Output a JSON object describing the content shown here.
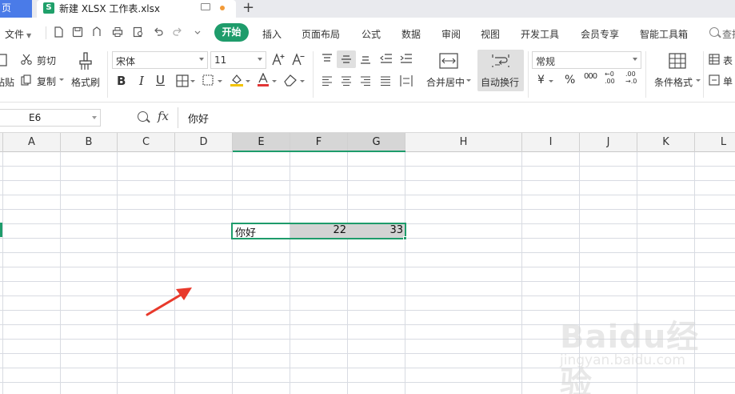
{
  "tabbar": {
    "home_label": "页",
    "file_icon_letter": "S",
    "file_title": "新建 XLSX 工作表.xlsx",
    "add_label": "+"
  },
  "menubar": {
    "file_label": "文件",
    "items": [
      "插入",
      "页面布局",
      "公式",
      "数据",
      "审阅",
      "视图",
      "开发工具",
      "会员专享",
      "智能工具箱"
    ],
    "active_label": "开始",
    "search_label": "查找"
  },
  "ribbon": {
    "paste_label": "粘贴",
    "cut_label": "剪切",
    "copy_label": "复制",
    "format_painter_label": "格式刷",
    "font_name": "宋体",
    "font_size": "11",
    "merge_label": "合并居中",
    "wrap_label": "自动换行",
    "number_format": "常规",
    "conditional_format_label": "条件格式",
    "table_style_label": "表",
    "single_label": "单"
  },
  "formula": {
    "cell_ref": "E6",
    "fx_label": "fx",
    "value": "你好"
  },
  "grid": {
    "columns": [
      "A",
      "B",
      "C",
      "D",
      "E",
      "F",
      "G",
      "H",
      "I",
      "J",
      "K",
      "L"
    ],
    "selected_columns": [
      "E",
      "F",
      "G"
    ],
    "cells": {
      "E6": "你好",
      "F6": "22",
      "G6": "33"
    }
  },
  "colors": {
    "accent": "#1e9c6b",
    "home_tab": "#4a7be8",
    "arrow": "#e8392b"
  },
  "watermark": {
    "brand": "Baidu经验",
    "url": "jingyan.baidu.com"
  }
}
